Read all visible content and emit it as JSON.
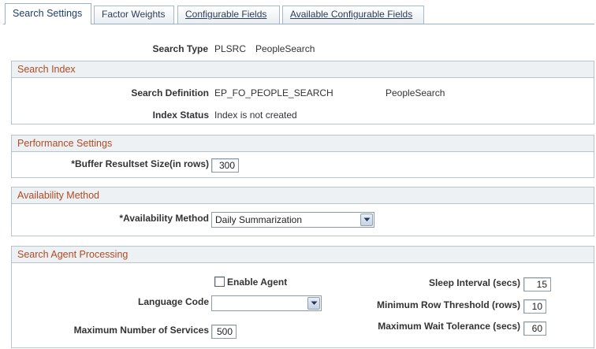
{
  "tabs": [
    {
      "label": "Search Settings",
      "active": true
    },
    {
      "label": "Factor Weights",
      "active": false
    },
    {
      "label": "Configurable Fields",
      "active": false
    },
    {
      "label": "Available Configurable Fields",
      "active": false
    }
  ],
  "search_type": {
    "label": "Search Type",
    "code": "PLSRC",
    "name": "PeopleSearch"
  },
  "search_index": {
    "title": "Search Index",
    "definition_label": "Search Definition",
    "definition_value": "EP_FO_PEOPLE_SEARCH",
    "definition_desc": "PeopleSearch",
    "status_label": "Index Status",
    "status_value": "Index is not created"
  },
  "performance": {
    "title": "Performance Settings",
    "buffer_label": "*Buffer Resultset Size(in rows)",
    "buffer_value": "300"
  },
  "availability": {
    "title": "Availability Method",
    "method_label": "*Availability Method",
    "method_value": "Daily Summarization"
  },
  "agent": {
    "title": "Search Agent Processing",
    "enable_label": "Enable Agent",
    "enable_checked": false,
    "language_label": "Language Code",
    "language_value": "",
    "max_services_label": "Maximum Number of Services",
    "max_services_value": "500",
    "sleep_label": "Sleep Interval (secs)",
    "sleep_value": "15",
    "min_row_label": "Minimum Row Threshold (rows)",
    "min_row_value": "10",
    "max_wait_label": "Maximum Wait Tolerance (secs)",
    "max_wait_value": "60"
  },
  "colors": {
    "section_title": "#b04a24",
    "tab_text": "#1f3f66",
    "border": "#b9c3cc"
  }
}
